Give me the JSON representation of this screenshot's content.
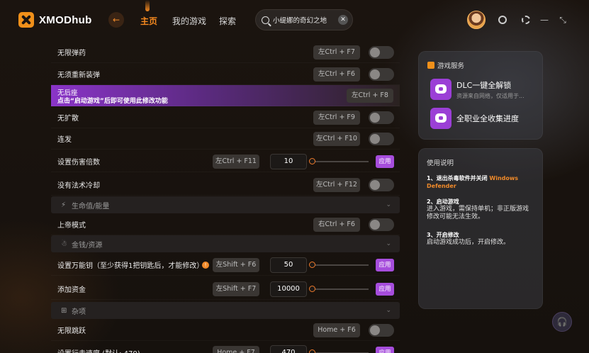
{
  "app": {
    "name": "XMODhub"
  },
  "nav": {
    "back": "←",
    "items": [
      "主页",
      "我的游戏",
      "探索"
    ]
  },
  "search": {
    "value": "小缇娜的奇幻之地",
    "clear": "✕"
  },
  "window": {
    "min": "—",
    "max": "⤡"
  },
  "cheats": [
    {
      "label": "无限弹药",
      "hotkey": "左Ctrl + F7",
      "type": "toggle"
    },
    {
      "label": "无须重新装弹",
      "hotkey": "左Ctrl + F6",
      "type": "toggle"
    },
    {
      "label": "无后座",
      "hotkey": "左Ctrl + F8",
      "type": "highlight",
      "notice": "点击“启动游戏”后即可使用此修改功能"
    },
    {
      "label": "无扩散",
      "hotkey": "左Ctrl + F9",
      "type": "toggle"
    },
    {
      "label": "连发",
      "hotkey": "左Ctrl + F10",
      "type": "toggle"
    },
    {
      "label": "设置伤害倍数",
      "hotkey": "左Ctrl + F11",
      "type": "value",
      "value": "10",
      "apply": "应用"
    },
    {
      "label": "没有法术冷却",
      "hotkey": "左Ctrl + F12",
      "type": "toggle"
    }
  ],
  "sections": {
    "health": {
      "label": "生命值/能量",
      "icon": "⚡",
      "chevron": "⌄"
    },
    "money": {
      "label": "金钱/资源",
      "icon": "☃",
      "chevron": "⌄"
    },
    "misc": {
      "label": "杂项",
      "icon": "⊞",
      "chevron": "⌄"
    }
  },
  "health_rows": [
    {
      "label": "上帝模式",
      "hotkey": "右Ctrl + F6"
    }
  ],
  "money_rows": [
    {
      "label": "设置万能钥（至少获得1把钥匙后，才能修改）",
      "hotkey": "左Shift + F6",
      "value": "50",
      "apply": "应用",
      "info": "!"
    },
    {
      "label": "添加资金",
      "hotkey": "左Shift + F7",
      "value": "10000",
      "apply": "应用"
    }
  ],
  "misc_rows": [
    {
      "label": "无限跳跃",
      "hotkey": "Home + F6"
    },
    {
      "label": "设置行走速度 (默认: 470)",
      "hotkey": "Home + F7",
      "value": "470",
      "apply": "应用"
    }
  ],
  "services": {
    "title": "游戏服务",
    "items": [
      {
        "name": "DLC一键全解锁",
        "sub": "资源来自网络，仅适用于..."
      },
      {
        "name": "全职业全收集进度",
        "sub": ""
      }
    ]
  },
  "instructions": {
    "title": "使用说明",
    "steps": [
      {
        "head": "1、退出杀毒软件并关闭",
        "highlight": "Windows Defender",
        "body": ""
      },
      {
        "head": "2、启动游戏",
        "highlight": "",
        "body": "进入游戏，需保持单机；非正版游戏修改可能无法生效。"
      },
      {
        "head": "3、开启修改",
        "highlight": "",
        "body": "启动游戏成功后，开启修改。"
      }
    ]
  },
  "support": {
    "icon": "headset-icon",
    "glyph": "🎧"
  },
  "colors": {
    "accent": "#f5891f",
    "purple": "#a64ddc",
    "bg": "#1a1410"
  }
}
